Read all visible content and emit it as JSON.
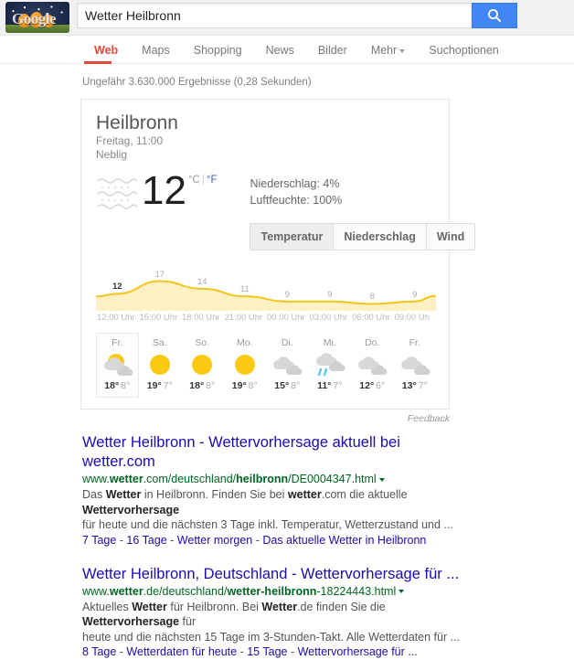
{
  "header": {
    "doodle_alt": "Halloween Google Doodle",
    "doodle_glyph": "Google",
    "search_value": "Wetter Heilbronn",
    "search_placeholder": "",
    "search_button_icon": "search-icon"
  },
  "nav": {
    "items": [
      {
        "label": "Web",
        "active": true
      },
      {
        "label": "Maps",
        "active": false
      },
      {
        "label": "Shopping",
        "active": false
      },
      {
        "label": "News",
        "active": false
      },
      {
        "label": "Bilder",
        "active": false
      },
      {
        "label": "Mehr",
        "active": false,
        "has_caret": true
      },
      {
        "label": "Suchoptionen",
        "active": false
      }
    ]
  },
  "stats": "Ungefähr 3.630.000 Ergebnisse (0,28 Sekunden)",
  "weather": {
    "city": "Heilbronn",
    "datetime": "Freitag, 11:00",
    "condition": "Neblig",
    "condition_icon": "fog-icon",
    "temperature": "12",
    "unit_celsius": "°C",
    "unit_separator": "|",
    "unit_fahrenheit": "°F",
    "precipitation_label": "Niederschlag: 4%",
    "humidity_label": "Luftfeuchte: 100%",
    "toggles": [
      {
        "label": "Temperatur",
        "active": true
      },
      {
        "label": "Niederschlag",
        "active": false
      },
      {
        "label": "Wind",
        "active": false
      }
    ],
    "feedback_label": "Feedback",
    "forecast": [
      {
        "day": "Fr.",
        "icon": "partly-sunny-icon",
        "high": "18°",
        "low": "8°",
        "selected": true
      },
      {
        "day": "Sa.",
        "icon": "sunny-icon",
        "high": "19°",
        "low": "7°",
        "selected": false
      },
      {
        "day": "So.",
        "icon": "sunny-icon",
        "high": "18°",
        "low": "8°",
        "selected": false
      },
      {
        "day": "Mo.",
        "icon": "sunny-icon",
        "high": "19°",
        "low": "8°",
        "selected": false
      },
      {
        "day": "Di.",
        "icon": "cloudy-icon",
        "high": "15°",
        "low": "8°",
        "selected": false
      },
      {
        "day": "Mi.",
        "icon": "rain-icon",
        "high": "11°",
        "low": "7°",
        "selected": false
      },
      {
        "day": "Do.",
        "icon": "cloudy-icon",
        "high": "12°",
        "low": "6°",
        "selected": false
      },
      {
        "day": "Fr.",
        "icon": "cloudy-icon",
        "high": "13°",
        "low": "7°",
        "selected": false
      }
    ]
  },
  "chart_data": {
    "type": "area",
    "title": "",
    "xlabel": "",
    "ylabel": "",
    "categories": [
      "12:00 Uhr",
      "15:00 Uhr",
      "18:00 Uhr",
      "21:00 Uhr",
      "00:00 Uhr",
      "03:00 Uhr",
      "06:00 Uhr",
      "09:00 Uh"
    ],
    "values": [
      12,
      17,
      14,
      11,
      9,
      9,
      8,
      9
    ],
    "point_labels": [
      "12",
      "17",
      "14",
      "11",
      "9",
      "9",
      "8",
      "9"
    ],
    "current_index": 0,
    "ylim": [
      6,
      19
    ],
    "grid": false,
    "legend": "none",
    "line_color": "#f5c518",
    "fill_color": "#fdf0c4"
  },
  "results": [
    {
      "title": "Wetter Heilbronn - Wettervorhersage aktuell bei wetter.com",
      "url_prefix": "www.",
      "url_bold1": "wetter",
      "url_mid": ".com/deutschland/",
      "url_bold2": "heilbronn",
      "url_suffix": "/DE0004347.html",
      "snippet_line1_a": "Das ",
      "snippet_line1_b": "Wetter",
      "snippet_line1_c": " in Heilbronn. Finden Sie bei ",
      "snippet_line1_d": "wetter",
      "snippet_line1_e": ".com die aktuelle ",
      "snippet_line1_f": "Wettervorhersage",
      "snippet_line2": "für heute und die nächsten 3 Tage inkl. Temperatur, Wetterzustand und ...",
      "sitelinks": [
        "7 Tage",
        "16 Tage",
        "Wetter morgen",
        "Das aktuelle Wetter in Heilbronn"
      ]
    },
    {
      "title": "Wetter Heilbronn, Deutschland - Wettervorhersage für ...",
      "url_prefix": "www.",
      "url_bold1": "wetter",
      "url_mid": ".de/deutschland/",
      "url_bold2": "wetter-heilbronn",
      "url_suffix": "-18224443.html",
      "snippet_line1_a": "Aktuelles ",
      "snippet_line1_b": "Wetter",
      "snippet_line1_c": " für Heilbronn. Bei ",
      "snippet_line1_d": "Wetter",
      "snippet_line1_e": ".de finden Sie die ",
      "snippet_line1_f": "Wettervorhersage",
      "snippet_line1_g": " für",
      "snippet_line2": "heute und die nächsten 15 Tage im 3-Stunden-Takt. Alle Wetterdaten für ...",
      "sitelinks": [
        "8 Tage",
        "Wetterdaten für heute",
        "15 Tage",
        "Wettervorhersage für ..."
      ]
    }
  ]
}
